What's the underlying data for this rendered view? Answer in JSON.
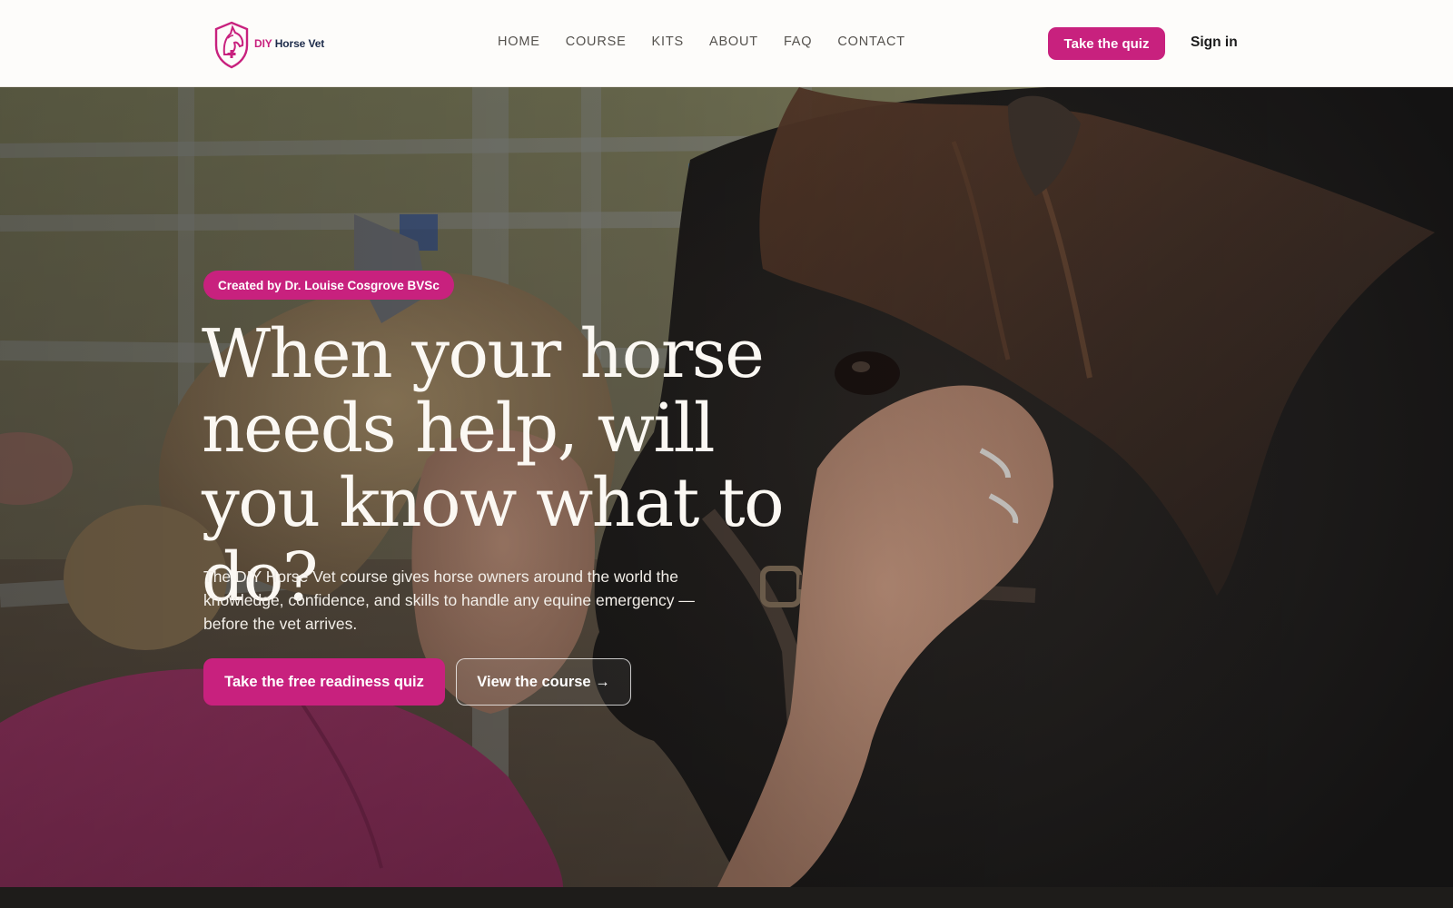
{
  "brand": {
    "logo_diy": "DIY",
    "logo_rest": " Horse Vet",
    "accent_color": "#c8217e",
    "navy_color": "#1d2b4a"
  },
  "nav": {
    "items": [
      {
        "label": "HOME"
      },
      {
        "label": "COURSE"
      },
      {
        "label": "KITS"
      },
      {
        "label": "ABOUT"
      },
      {
        "label": "FAQ"
      },
      {
        "label": "CONTACT"
      }
    ],
    "quiz_button": "Take the quiz",
    "signin_link": "Sign in"
  },
  "hero": {
    "badge": "Created by Dr. Louise Cosgrove BVSc",
    "headline": "When your horse needs help, will you know what to do?",
    "subcopy": "The DIY Horse Vet course gives horse owners around the world the knowledge, confidence, and skills to handle any equine emergency — before the vet arrives.",
    "primary_cta": "Take the free readiness quiz",
    "secondary_cta": "View the course →",
    "background_image": "photo-woman-with-pony"
  }
}
